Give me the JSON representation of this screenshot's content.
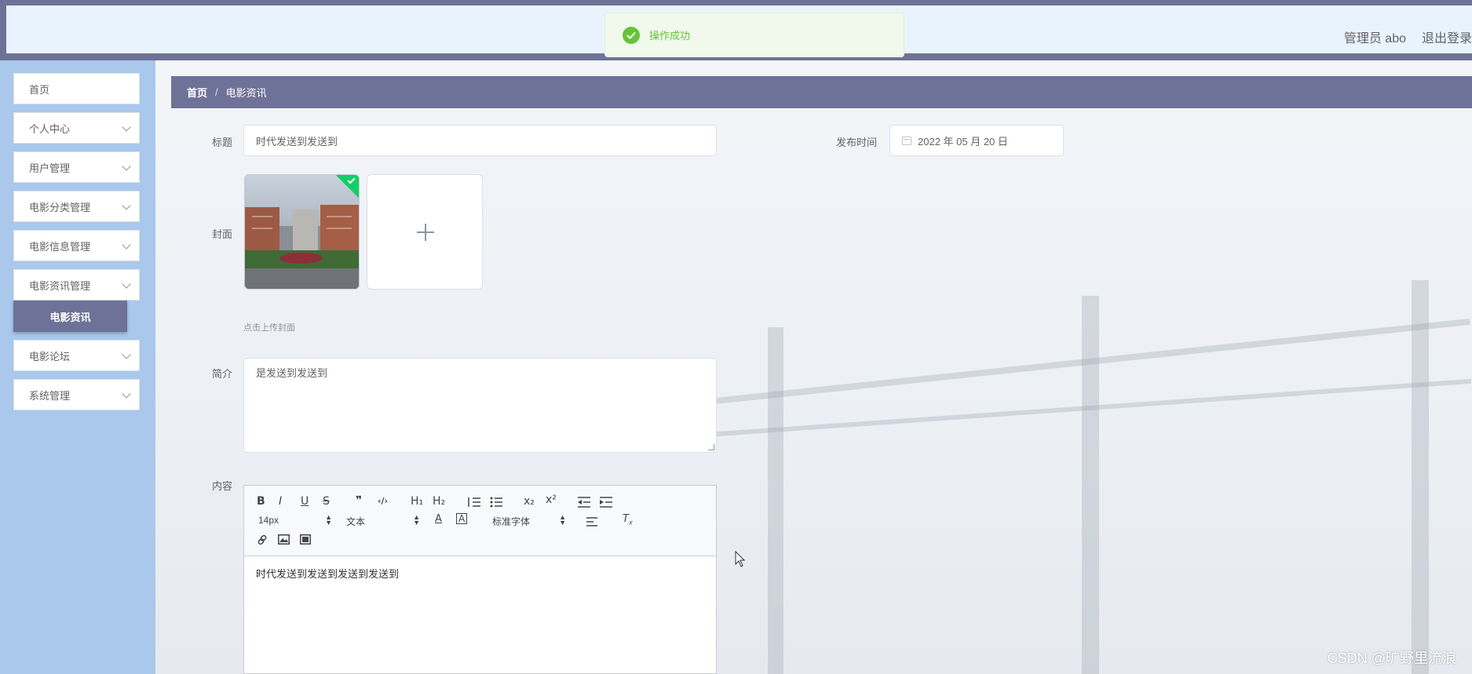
{
  "header": {
    "user_label": "管理员 abo",
    "logout_label": "退出登录"
  },
  "toast": {
    "message": "操作成功",
    "status_color": "#67c23a"
  },
  "sidebar": {
    "items": [
      {
        "label": "首页",
        "expandable": false
      },
      {
        "label": "个人中心",
        "expandable": true
      },
      {
        "label": "用户管理",
        "expandable": true
      },
      {
        "label": "电影分类管理",
        "expandable": true
      },
      {
        "label": "电影信息管理",
        "expandable": true
      },
      {
        "label": "电影资讯管理",
        "expandable": true,
        "open": true
      },
      {
        "label": "电影论坛",
        "expandable": true
      },
      {
        "label": "系统管理",
        "expandable": true
      }
    ],
    "active_sub": "电影资讯"
  },
  "breadcrumb": {
    "home": "首页",
    "separator": "/",
    "current": "电影资讯"
  },
  "form": {
    "title_label": "标题",
    "title_value": "时代发送到发送到",
    "publish_label": "发布时间",
    "publish_value": "2022 年 05 月 20 日",
    "cover_label": "封面",
    "cover_hint": "点击上传封面",
    "intro_label": "简介",
    "intro_value": "是发送到发送到",
    "content_label": "内容",
    "content_value": "时代发送到发送到发送到发送到"
  },
  "editor_toolbar": {
    "row1": [
      "B",
      "I",
      "U",
      "S",
      "❞",
      "‹/›",
      "H₁",
      "H₂",
      "ordered-list-icon",
      "bullet-list-icon",
      "x₂",
      "x²",
      "outdent-icon",
      "indent-icon"
    ],
    "size_value": "14px",
    "header_value": "文本",
    "font_value": "标准字体",
    "row3": [
      "link-icon",
      "image-icon",
      "video-icon"
    ]
  },
  "watermark": "CSDN @旷野里流浪",
  "colors": {
    "accent": "#6f7298",
    "sidebar_bg": "#a9c8ec",
    "header_bg": "#e9f3fd",
    "success": "#13ce66"
  }
}
